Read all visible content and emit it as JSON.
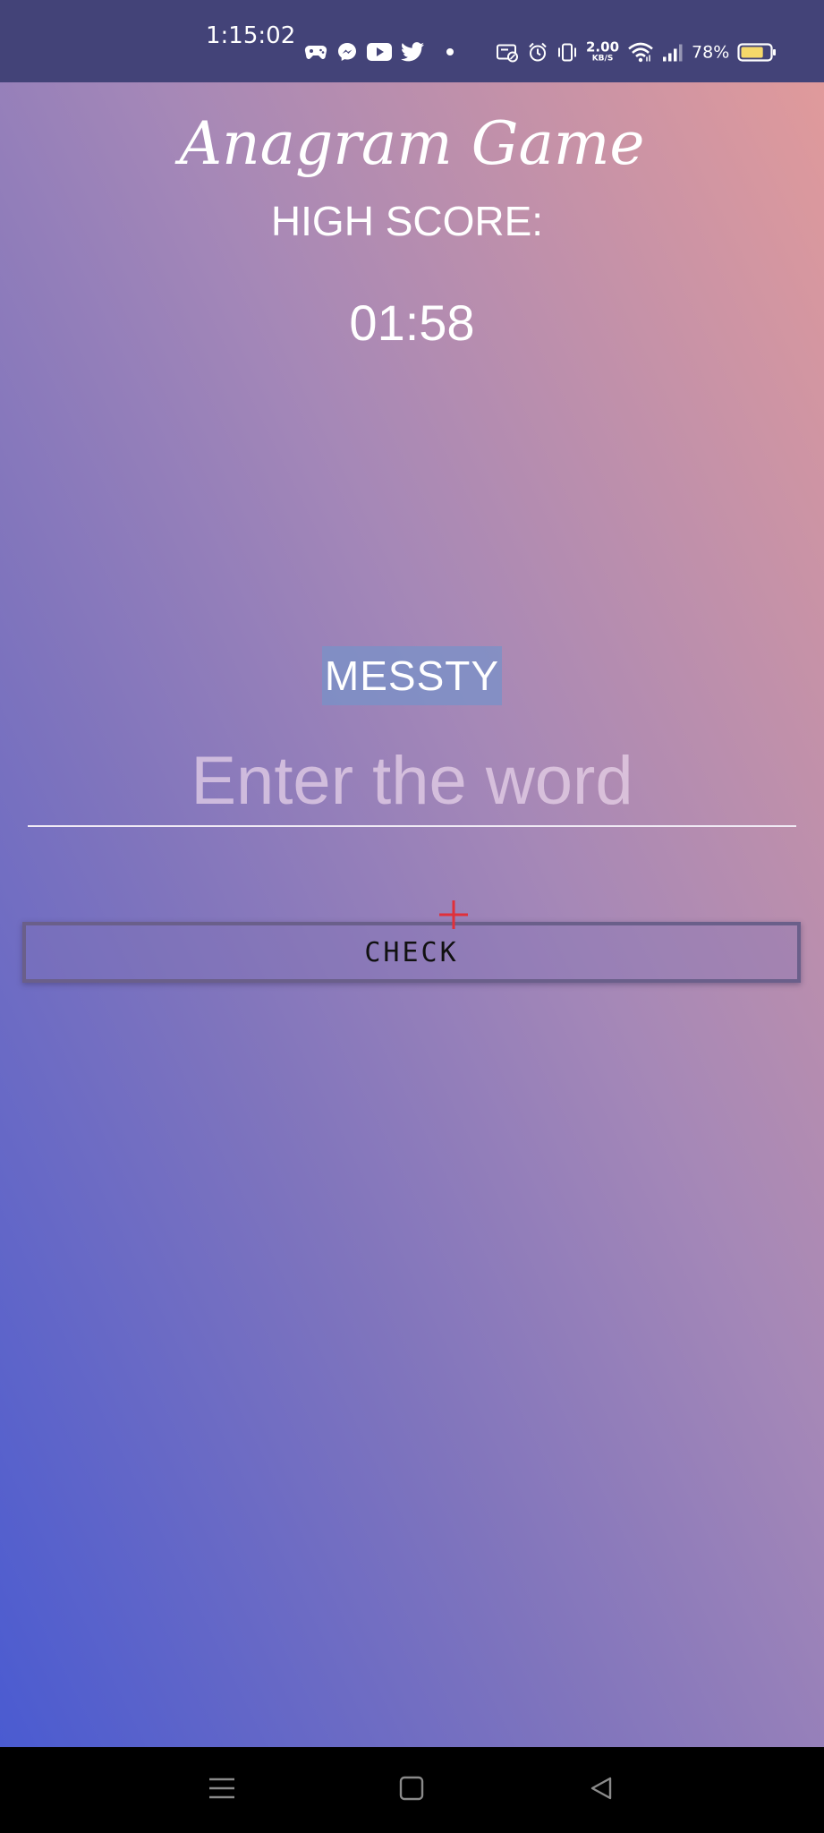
{
  "status_bar": {
    "time": "1:15:02",
    "left_icons": [
      "game-controller-icon",
      "messenger-icon",
      "youtube-icon",
      "twitter-icon",
      "dot-icon"
    ],
    "net_speed_value": "2.00",
    "net_speed_unit": "KB/S",
    "battery_percent": "78%",
    "battery_level": 0.78,
    "battery_color": "#f5d86a"
  },
  "app": {
    "title": "Anagram Game",
    "high_score_label": "HIGH SCORE:",
    "timer": "01:58",
    "scrambled_word": "MESSTY",
    "input_placeholder": "Enter the word",
    "input_value": "",
    "check_button": "CHECK"
  },
  "colors": {
    "status_bar_bg": "#434378",
    "gradient_top_right": "#e09a9b",
    "gradient_bottom_left": "#4a5bd1",
    "highlight": "#7891c8",
    "crosshair": "#e0303a"
  },
  "nav_bar": {
    "buttons": [
      "menu-icon",
      "home-icon",
      "back-icon"
    ]
  }
}
